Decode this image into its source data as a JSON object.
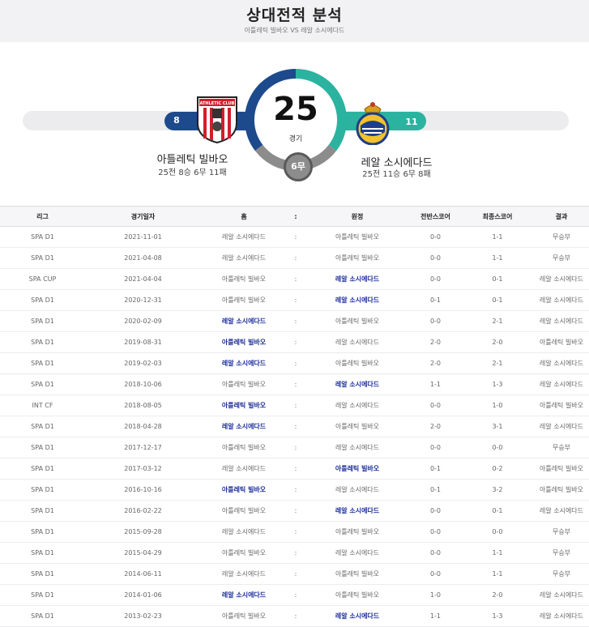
{
  "page": {
    "title": "상대전적 분석",
    "subtitle": "아틀레틱 빌바오 VS 레알 소시에다드"
  },
  "summary": {
    "total_games": "25",
    "total_label": "경기",
    "draws_label": "6무",
    "home": {
      "name": "아틀레틱 빌바오",
      "record": "25전 8승 6무 11패",
      "wins": "8",
      "crest_text": "ATHLETIC CLUB"
    },
    "away": {
      "name": "레알 소시에다드",
      "record": "25전 11승 6무 8패",
      "wins": "11"
    },
    "colors": {
      "home": "#1d4a8c",
      "away": "#2bb3a0",
      "draw": "#8c8c8c",
      "winner_text": "#1c2e9a"
    }
  },
  "table": {
    "headers": {
      "league": "리그",
      "date": "경기일자",
      "home": "홈",
      "sep": ":",
      "away": "원정",
      "half": "전반스코어",
      "final": "최종스코어",
      "result": "결과"
    },
    "rows": [
      {
        "league": "SPA D1",
        "date": "2021-11-01",
        "home": "레알 소시에다드",
        "sep": ":",
        "away": "아틀레틱 빌바오",
        "half": "0-0",
        "final": "1-1",
        "result": "무승부",
        "winner": ""
      },
      {
        "league": "SPA D1",
        "date": "2021-04-08",
        "home": "레알 소시에다드",
        "sep": ":",
        "away": "아틀레틱 빌바오",
        "half": "0-0",
        "final": "1-1",
        "result": "무승부",
        "winner": ""
      },
      {
        "league": "SPA CUP",
        "date": "2021-04-04",
        "home": "아틀레틱 빌바오",
        "sep": ":",
        "away": "레알 소시에다드",
        "half": "0-0",
        "final": "0-1",
        "result": "레알 소시에다드",
        "winner": "away"
      },
      {
        "league": "SPA D1",
        "date": "2020-12-31",
        "home": "아틀레틱 빌바오",
        "sep": ":",
        "away": "레알 소시에다드",
        "half": "0-1",
        "final": "0-1",
        "result": "레알 소시에다드",
        "winner": "away"
      },
      {
        "league": "SPA D1",
        "date": "2020-02-09",
        "home": "레알 소시에다드",
        "sep": ":",
        "away": "아틀레틱 빌바오",
        "half": "0-0",
        "final": "2-1",
        "result": "레알 소시에다드",
        "winner": "home"
      },
      {
        "league": "SPA D1",
        "date": "2019-08-31",
        "home": "아틀레틱 빌바오",
        "sep": ":",
        "away": "레알 소시에다드",
        "half": "2-0",
        "final": "2-0",
        "result": "아틀레틱 빌바오",
        "winner": "home"
      },
      {
        "league": "SPA D1",
        "date": "2019-02-03",
        "home": "레알 소시에다드",
        "sep": ":",
        "away": "아틀레틱 빌바오",
        "half": "2-0",
        "final": "2-1",
        "result": "레알 소시에다드",
        "winner": "home"
      },
      {
        "league": "SPA D1",
        "date": "2018-10-06",
        "home": "아틀레틱 빌바오",
        "sep": ":",
        "away": "레알 소시에다드",
        "half": "1-1",
        "final": "1-3",
        "result": "레알 소시에다드",
        "winner": "away"
      },
      {
        "league": "INT CF",
        "date": "2018-08-05",
        "home": "아틀레틱 빌바오",
        "sep": ":",
        "away": "레알 소시에다드",
        "half": "0-0",
        "final": "1-0",
        "result": "아틀레틱 빌바오",
        "winner": "home"
      },
      {
        "league": "SPA D1",
        "date": "2018-04-28",
        "home": "레알 소시에다드",
        "sep": ":",
        "away": "아틀레틱 빌바오",
        "half": "2-0",
        "final": "3-1",
        "result": "레알 소시에다드",
        "winner": "home"
      },
      {
        "league": "SPA D1",
        "date": "2017-12-17",
        "home": "아틀레틱 빌바오",
        "sep": ":",
        "away": "레알 소시에다드",
        "half": "0-0",
        "final": "0-0",
        "result": "무승부",
        "winner": ""
      },
      {
        "league": "SPA D1",
        "date": "2017-03-12",
        "home": "레알 소시에다드",
        "sep": ":",
        "away": "아틀레틱 빌바오",
        "half": "0-1",
        "final": "0-2",
        "result": "아틀레틱 빌바오",
        "winner": "away"
      },
      {
        "league": "SPA D1",
        "date": "2016-10-16",
        "home": "아틀레틱 빌바오",
        "sep": ":",
        "away": "레알 소시에다드",
        "half": "0-1",
        "final": "3-2",
        "result": "아틀레틱 빌바오",
        "winner": "home"
      },
      {
        "league": "SPA D1",
        "date": "2016-02-22",
        "home": "아틀레틱 빌바오",
        "sep": ":",
        "away": "레알 소시에다드",
        "half": "0-0",
        "final": "0-1",
        "result": "레알 소시에다드",
        "winner": "away"
      },
      {
        "league": "SPA D1",
        "date": "2015-09-28",
        "home": "레알 소시에다드",
        "sep": ":",
        "away": "아틀레틱 빌바오",
        "half": "0-0",
        "final": "0-0",
        "result": "무승부",
        "winner": ""
      },
      {
        "league": "SPA D1",
        "date": "2015-04-29",
        "home": "아틀레틱 빌바오",
        "sep": ":",
        "away": "레알 소시에다드",
        "half": "0-0",
        "final": "1-1",
        "result": "무승부",
        "winner": ""
      },
      {
        "league": "SPA D1",
        "date": "2014-06-11",
        "home": "레알 소시에다드",
        "sep": ":",
        "away": "아틀레틱 빌바오",
        "half": "0-0",
        "final": "1-1",
        "result": "무승부",
        "winner": ""
      },
      {
        "league": "SPA D1",
        "date": "2014-01-06",
        "home": "레알 소시에다드",
        "sep": ":",
        "away": "아틀레틱 빌바오",
        "half": "1-0",
        "final": "2-0",
        "result": "레알 소시에다드",
        "winner": "home"
      },
      {
        "league": "SPA D1",
        "date": "2013-02-23",
        "home": "아틀레틱 빌바오",
        "sep": ":",
        "away": "레알 소시에다드",
        "half": "1-1",
        "final": "1-3",
        "result": "레알 소시에다드",
        "winner": "away"
      }
    ]
  }
}
